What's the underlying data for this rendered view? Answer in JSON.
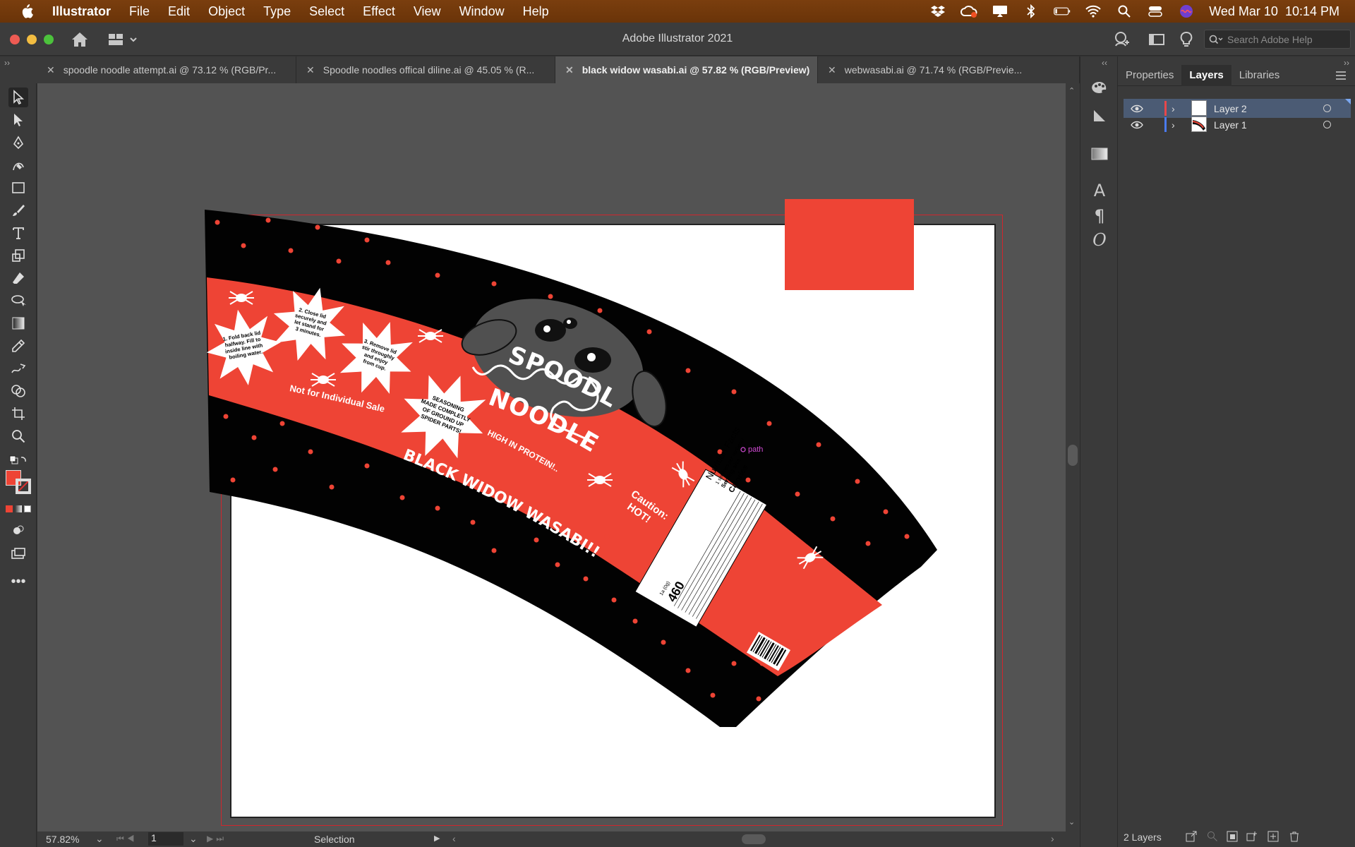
{
  "menubar": {
    "app_name": "Illustrator",
    "items": [
      "File",
      "Edit",
      "Object",
      "Type",
      "Select",
      "Effect",
      "View",
      "Window",
      "Help"
    ],
    "clock": "Wed Mar 10  10:14 PM"
  },
  "window": {
    "title": "Adobe Illustrator 2021",
    "search_placeholder": "Search Adobe Help"
  },
  "tabs": [
    {
      "label": "spoodle noodle attempt.ai @ 73.12 % (RGB/Pr...",
      "active": false
    },
    {
      "label": "Spoodle noodles offical diline.ai @ 45.05 % (R...",
      "active": false
    },
    {
      "label": "black widow wasabi.ai @ 57.82 % (RGB/Preview)",
      "active": true
    },
    {
      "label": "webwasabi.ai @ 71.74 % (RGB/Previe...",
      "active": false
    }
  ],
  "artwork": {
    "brand_line1": "SPOODLE",
    "brand_line2": "NOODLES",
    "tagline": "HIGH IN PROTEIN!..",
    "flavor": "BLACK WIDOW WASABI!!",
    "not_for_sale": "Not for Individual Sale",
    "caution_line1": "Caution:",
    "caution_line2": "HOT!",
    "step1": [
      "1. Fold back lid",
      "halfway. Fill to",
      "inside line with",
      "boiling water."
    ],
    "step2": [
      "2. Close lid",
      "securely and",
      "let stand for",
      "3 minutes."
    ],
    "step3": [
      "3. Remove lid",
      "stir throughly",
      "and enjoy",
      "from cup."
    ],
    "seasoning": [
      "SEASONING",
      "MADE COMPLETLY",
      "OF GROUND UP",
      "SPIDER PARTS!"
    ],
    "nutrition_title": "Nutrition Facts",
    "nutrition_servings": "1 servings per container",
    "nutrition_serving_size": "Serving size",
    "nutrition_calories": "Calories",
    "nutrition_calories_value": "460",
    "nutrition_amount": "1a (0g)",
    "path_label": "path",
    "swatch_color": "#ee4435"
  },
  "status": {
    "zoom": "57.82%",
    "page": "1",
    "mode": "Selection"
  },
  "panel": {
    "tabs": [
      "Properties",
      "Layers",
      "Libraries"
    ],
    "active_tab": "Layers",
    "layers": [
      {
        "name": "Layer 2",
        "color": "#e8474a",
        "selected": true
      },
      {
        "name": "Layer 1",
        "color": "#4a7bef",
        "selected": false
      }
    ],
    "layer_count": "2 Layers"
  }
}
